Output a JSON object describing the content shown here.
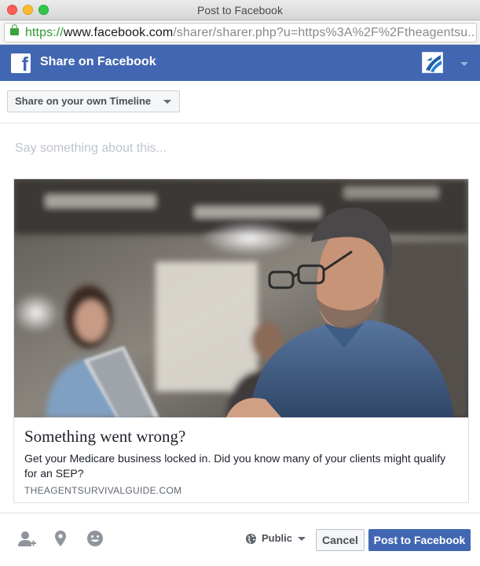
{
  "window": {
    "title": "Post to Facebook"
  },
  "urlbar": {
    "scheme": "https://",
    "host": "www.facebook.com",
    "path": "/sharer/sharer.php?u=https%3A%2F%2Ftheagentsu..."
  },
  "header": {
    "logo_letter": "f",
    "title": "Share on Facebook"
  },
  "share_target": {
    "label": "Share on your own Timeline"
  },
  "composer": {
    "placeholder": "Say something about this...",
    "value": ""
  },
  "card": {
    "title": "Something went wrong?",
    "description": "Get your Medicare business locked in. Did you know many of your clients might qualify for an SEP?",
    "domain": "THEAGENTSURVIVALGUIDE.COM"
  },
  "footer": {
    "icons": [
      "tag-people-icon",
      "location-pin-icon",
      "feeling-smiley-icon"
    ],
    "audience": "Public",
    "cancel_label": "Cancel",
    "post_label": "Post to Facebook"
  },
  "colors": {
    "brand": "#4267b2",
    "secure_green": "#2f9a2f"
  }
}
